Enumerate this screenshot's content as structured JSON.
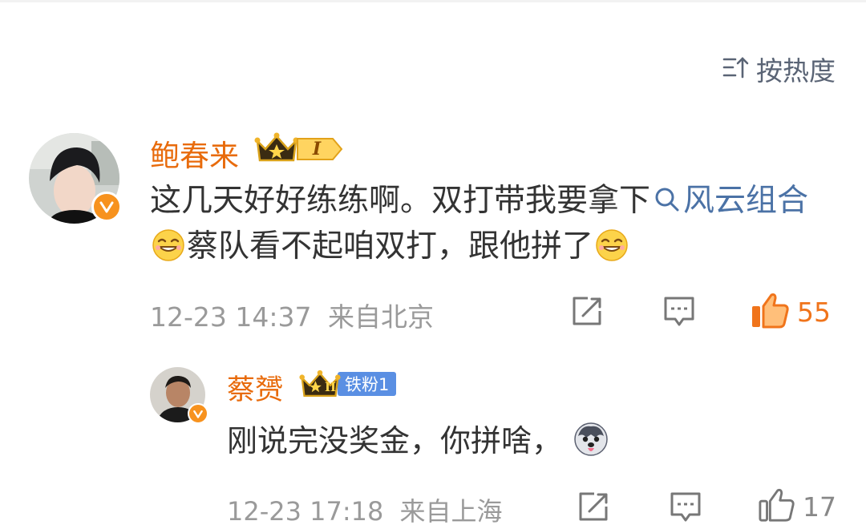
{
  "sort": {
    "label": "按热度",
    "icon": "sort-icon"
  },
  "comment": {
    "author": "鲍春来",
    "level": "I",
    "text_parts": [
      "这几天好好练练啊。双打带我要拿下",
      "风云组合",
      "蔡队看不起咱双打，跟他拼了"
    ],
    "time": "12-23 14:37",
    "location": "来自北京",
    "likes": "55",
    "liked": true,
    "accent_color": "#f7921e"
  },
  "reply": {
    "author": "蔡赟",
    "level": "II",
    "fan_badge": "铁粉1",
    "text": "刚说完没奖金，你拼啥，",
    "time": "12-23 17:18",
    "location": "来自上海",
    "likes": "17",
    "liked": false
  }
}
